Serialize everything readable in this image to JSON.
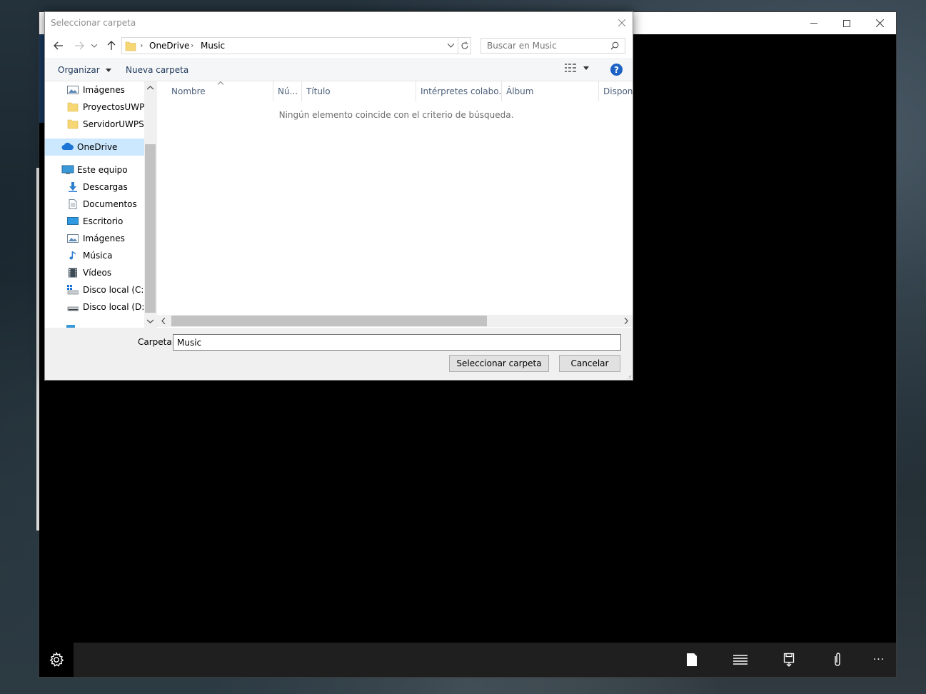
{
  "dialog": {
    "title": "Seleccionar carpeta",
    "breadcrumb": [
      "OneDrive",
      "Music"
    ],
    "search_placeholder": "Buscar en Music",
    "organize_label": "Organizar",
    "new_folder_label": "Nueva carpeta",
    "help_label": "?",
    "nav_tree": [
      {
        "label": "Imágenes",
        "icon": "pictures-icon"
      },
      {
        "label": "ProyectosUWP",
        "icon": "folder-icon"
      },
      {
        "label": "ServidorUWPSoc",
        "icon": "folder-icon"
      },
      {
        "label": "OneDrive",
        "icon": "onedrive-icon",
        "selected": true
      },
      {
        "label": "Este equipo",
        "icon": "computer-icon"
      },
      {
        "label": "Descargas",
        "icon": "downloads-icon"
      },
      {
        "label": "Documentos",
        "icon": "documents-icon"
      },
      {
        "label": "Escritorio",
        "icon": "desktop-icon"
      },
      {
        "label": "Imágenes",
        "icon": "pictures-icon"
      },
      {
        "label": "Música",
        "icon": "music-icon"
      },
      {
        "label": "Vídeos",
        "icon": "videos-icon"
      },
      {
        "label": "Disco local (C:)",
        "icon": "drive-c-icon"
      },
      {
        "label": "Disco local (D:)",
        "icon": "drive-icon"
      }
    ],
    "columns": [
      "Nombre",
      "Nú...",
      "Título",
      "Intérpretes colabo...",
      "Álbum",
      "Disponi"
    ],
    "empty_message": "Ningún elemento coincide con el criterio de búsqueda.",
    "folder_label": "Carpeta:",
    "folder_value": "Music",
    "select_button": "Seleccionar carpeta",
    "cancel_button": "Cancelar"
  },
  "app": {
    "bottom_bar_icons": [
      "page-icon",
      "list-icon",
      "save-icon",
      "attach-icon",
      "more-icon"
    ],
    "more_label": "···"
  },
  "colors": {
    "accent": "#1c62c4",
    "selection": "#cce8ff",
    "app_background": "#000000"
  }
}
